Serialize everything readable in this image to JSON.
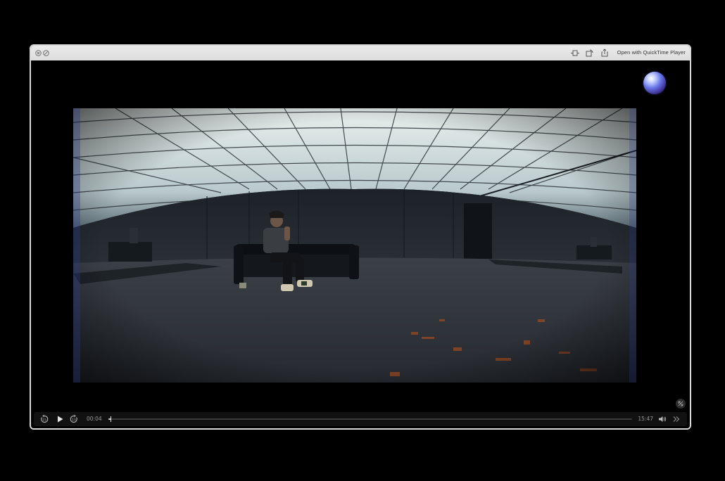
{
  "window": {
    "titlebar": {
      "close_icon": "close-x-icon",
      "minimize_icon": "slash-circle-icon",
      "open_with_label": "Open with QuickTime Player"
    }
  },
  "player": {
    "current_time": "00:04",
    "duration": "15:47",
    "progress": 0.005,
    "icons": {
      "skip_back": "skip-back-15-icon",
      "play": "play-icon",
      "skip_forward": "skip-forward-15-icon",
      "volume": "speaker-icon",
      "more": "chevron-double-right-icon",
      "expand": "expand-arrows-icon"
    }
  },
  "colors": {
    "titlebar": "#e3e3e3",
    "background": "#000000",
    "scrub_fill": "#cfcfcf"
  }
}
